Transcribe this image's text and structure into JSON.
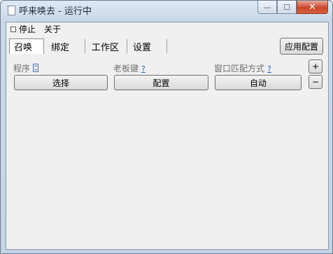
{
  "window": {
    "title": "呼来唤去 - 运行中",
    "minimize_glyph": "—",
    "maximize_glyph": "☐",
    "close_glyph": "✕"
  },
  "menu": {
    "items": [
      {
        "label": "停止",
        "icon": "stop-icon"
      },
      {
        "label": "关于"
      }
    ]
  },
  "tabs": [
    {
      "label": "召唤",
      "active": true
    },
    {
      "label": "绑定",
      "active": false
    },
    {
      "label": "工作区",
      "active": false
    },
    {
      "label": "设置",
      "active": false
    }
  ],
  "apply_button": "应用配置",
  "fields": [
    {
      "label": "程序",
      "help": "",
      "button": "选择"
    },
    {
      "label": "老板键",
      "help": "?",
      "button": "配置"
    },
    {
      "label": "窗口匹配方式",
      "help": "?",
      "button": "自动"
    }
  ],
  "side_buttons": {
    "add": "+",
    "remove": "−"
  },
  "colors": {
    "help_link": "#1b5fbf",
    "close_button": "#c9452b"
  }
}
